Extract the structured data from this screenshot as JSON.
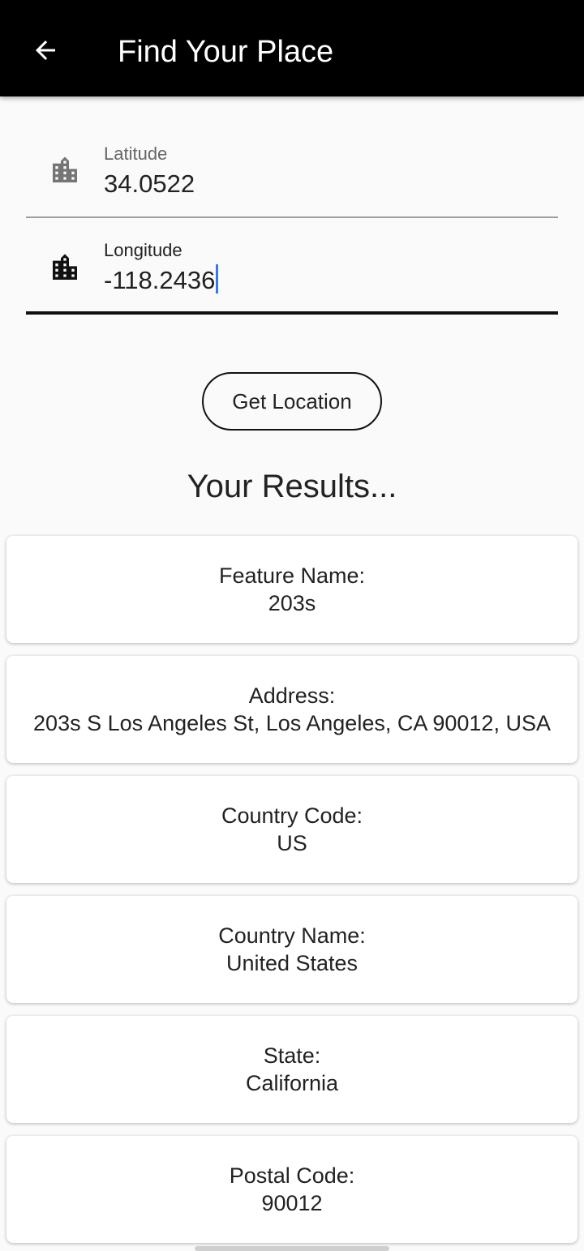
{
  "app_bar": {
    "title": "Find Your Place",
    "background_color": "#000000",
    "back_icon": "arrow-left-icon"
  },
  "form": {
    "latitude": {
      "label": "Latitude",
      "value": "34.0522",
      "icon": "building-icon",
      "focused": false
    },
    "longitude": {
      "label": "Longitude",
      "value": "-118.2436",
      "icon": "building-icon",
      "focused": true
    }
  },
  "get_location_button": {
    "label": "Get Location"
  },
  "results": {
    "heading": "Your Results...",
    "items": [
      {
        "label": "Feature Name:",
        "value": "203s"
      },
      {
        "label": "Address:",
        "value": "203s S Los Angeles St, Los Angeles, CA 90012, USA"
      },
      {
        "label": "Country Code:",
        "value": "US"
      },
      {
        "label": "Country Name:",
        "value": "United States"
      },
      {
        "label": "State:",
        "value": "California"
      },
      {
        "label": "Postal Code:",
        "value": "90012"
      }
    ]
  },
  "colors": {
    "page_background": "#fafafa",
    "caret": "#3b78e7",
    "unfocused_icon": "#757575",
    "focused_icon": "#111111"
  }
}
